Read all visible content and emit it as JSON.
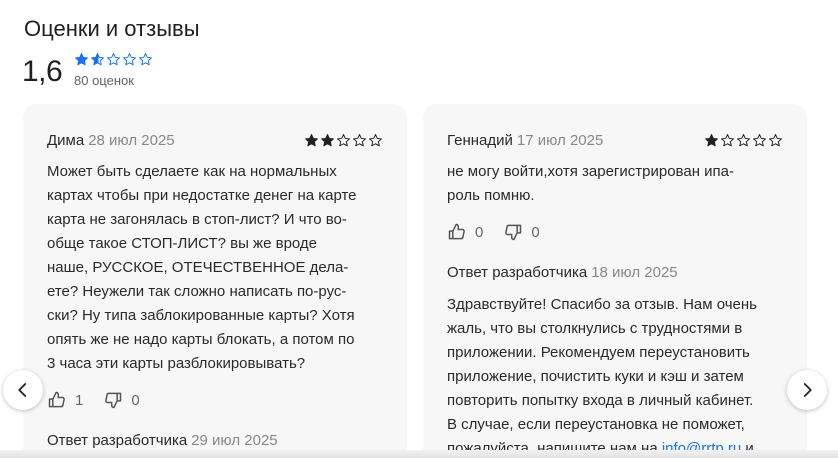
{
  "section": {
    "title": "Оценки и отзывы",
    "average_rating": "1,6",
    "rating_value": 1.6,
    "rating_count": "80 оценок",
    "star_color": "#1a73e8",
    "max_stars": 5
  },
  "reviews": [
    {
      "author": "Дима",
      "date": "28 июл 2025",
      "rating": 2,
      "text_lines": [
        "Может быть сделаете как на нормальных",
        "картах чтобы при недостатке денег на карте",
        "карта не загонялась в стоп-лист? И что во-",
        "обще такое СТОП-ЛИСТ? вы же вроде",
        "наше, РУССКОЕ, ОТЕЧЕСТВЕННОЕ дела-",
        "ете? Неужели так сложно написать по-рус-",
        "ски? Ну типа заблокированные карты? Хотя",
        "опять же не надо карты блокать, а потом по",
        "3 часа эти карты разблокировывать?"
      ],
      "likes": "1",
      "dislikes": "0",
      "developer_reply": {
        "label": "Ответ разработчика",
        "date": "29 июл 2025"
      }
    },
    {
      "author": "Геннадий",
      "date": "17 июл 2025",
      "rating": 1,
      "text_lines": [
        "не могу войти,хотя зарегистрирован ипа-",
        "роль помню."
      ],
      "likes": "0",
      "dislikes": "0",
      "developer_reply": {
        "label": "Ответ разработчика",
        "date": "18 июл 2025",
        "text_lines": [
          "Здравствуйте! Спасибо за отзыв. Нам очень",
          "жаль, что вы столкнулись с трудностями в",
          "приложении. Рекомендуем переустановить",
          "приложение, почистить куки и кэш и затем",
          "повторить попытку входа в личный кабинет.",
          "В случае, если переустановка не поможет,"
        ],
        "last_line_prefix": "пожалуйста, напишите нам на ",
        "email": "info@rrtp.ru",
        "last_line_suffix": " и"
      }
    }
  ],
  "navigation": {
    "prev_icon": "chevron-left-icon",
    "next_icon": "chevron-right-icon"
  }
}
